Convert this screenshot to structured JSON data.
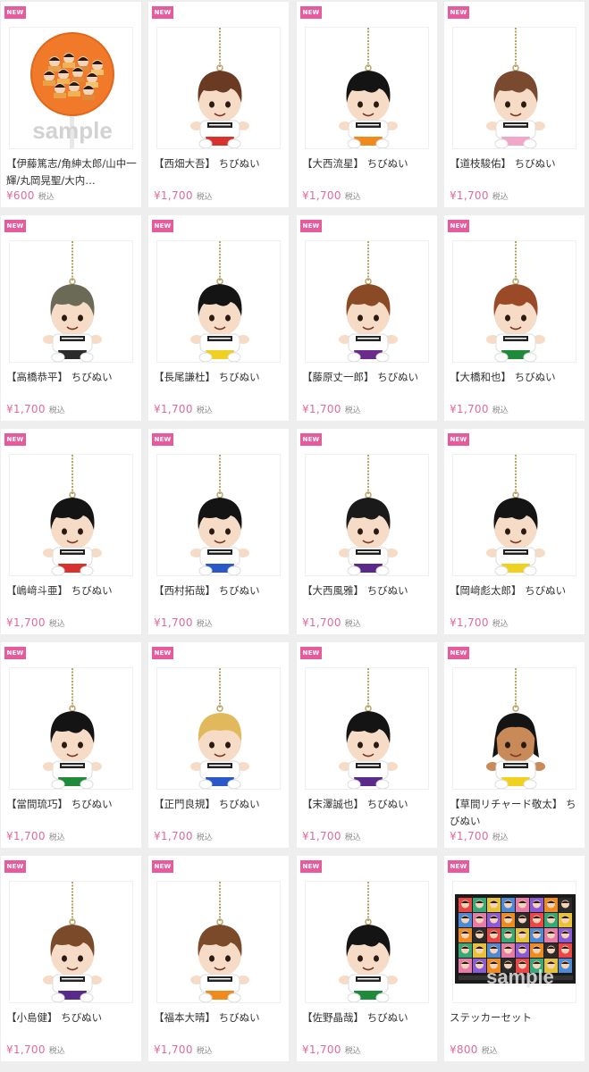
{
  "badge_label": "NEW",
  "tax_label": "税込",
  "sample_text": "sample",
  "products": [
    {
      "title": "【伊藤篤志/角紳太郎/山中一輝/丸岡晃聖/大内…",
      "price": "¥600",
      "type": "uchiwa"
    },
    {
      "title": "【西畑大吾】 ちびぬい",
      "price": "¥1,700",
      "hair": "#6b3a22",
      "shorts": "#d9322e",
      "style": "brown"
    },
    {
      "title": "【大西流星】 ちびぬい",
      "price": "¥1,700",
      "hair": "#141414",
      "shorts": "#f08a1c",
      "style": "black"
    },
    {
      "title": "【道枝駿佑】 ちびぬい",
      "price": "¥1,700",
      "hair": "#7a4a30",
      "shorts": "#f2a6c8",
      "style": "brown"
    },
    {
      "title": "【高橋恭平】 ちびぬい",
      "price": "¥1,700",
      "hair": "#6b6a56",
      "shorts": "#2b2b2b",
      "style": "ash"
    },
    {
      "title": "【長尾謙杜】 ちびぬい",
      "price": "¥1,700",
      "hair": "#141414",
      "shorts": "#f0d020",
      "style": "black"
    },
    {
      "title": "【藤原丈一郎】 ちびぬい",
      "price": "¥1,700",
      "hair": "#8a4a26",
      "shorts": "#6a2b8c",
      "style": "brown"
    },
    {
      "title": "【大橋和也】 ちびぬい",
      "price": "¥1,700",
      "hair": "#9a4a26",
      "shorts": "#1f8a3a",
      "style": "brown"
    },
    {
      "title": "【嶋﨑斗亜】 ちびぬい",
      "price": "¥1,700",
      "hair": "#141414",
      "shorts": "#d9322e",
      "style": "black"
    },
    {
      "title": "【西村拓哉】 ちびぬい",
      "price": "¥1,700",
      "hair": "#141414",
      "shorts": "#2a58c8",
      "style": "black"
    },
    {
      "title": "【大西風雅】 ちびぬい",
      "price": "¥1,700",
      "hair": "#1a1a1a",
      "shorts": "#5a2a8a",
      "style": "black"
    },
    {
      "title": "【岡﨑彪太郎】 ちびぬい",
      "price": "¥1,700",
      "hair": "#141414",
      "shorts": "#f0d020",
      "style": "black"
    },
    {
      "title": "【當間琉巧】 ちびぬい",
      "price": "¥1,700",
      "hair": "#141414",
      "shorts": "#1f8a3a",
      "style": "black"
    },
    {
      "title": "【正門良規】 ちびぬい",
      "price": "¥1,700",
      "hair": "#e2b85c",
      "shorts": "#2a58c8",
      "style": "blonde"
    },
    {
      "title": "【末澤誠也】 ちびぬい",
      "price": "¥1,700",
      "hair": "#141414",
      "shorts": "#5a2a8a",
      "style": "black"
    },
    {
      "title": "【草間リチャード敬太】 ちびぬい",
      "price": "¥1,700",
      "hair": "#141414",
      "shorts": "#f0d020",
      "style": "dark"
    },
    {
      "title": "【小島健】 ちびぬい",
      "price": "¥1,700",
      "hair": "#7a4a2a",
      "shorts": "#5a2a8a",
      "style": "brown"
    },
    {
      "title": "【福本大晴】 ちびぬい",
      "price": "¥1,700",
      "hair": "#7a4a2a",
      "shorts": "#f08a1c",
      "style": "brown"
    },
    {
      "title": "【佐野晶哉】 ちびぬい",
      "price": "¥1,700",
      "hair": "#141414",
      "shorts": "#1f8a3a",
      "style": "black"
    },
    {
      "title": "ステッカーセット",
      "price": "¥800",
      "type": "sticker"
    }
  ]
}
